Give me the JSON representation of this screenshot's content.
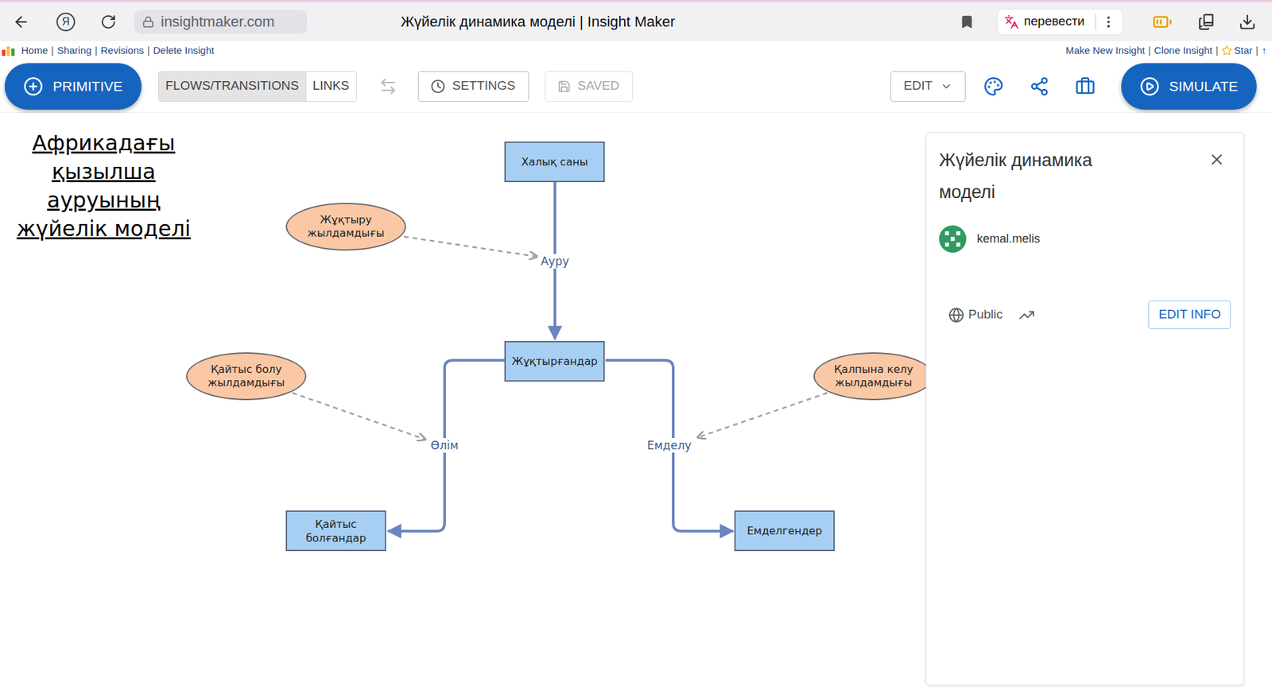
{
  "browser": {
    "yandex_logo": "Я",
    "address": "insightmaker.com",
    "title": "Жүйелік динамика моделі | Insight Maker",
    "translate": "перевести"
  },
  "links": {
    "separator": "|",
    "left": [
      "Home",
      "Sharing",
      "Revisions",
      "Delete Insight"
    ],
    "right": [
      {
        "label": "Make New Insight",
        "kind": "link"
      },
      {
        "label": "Clone Insight",
        "kind": "link"
      },
      {
        "label": "Star",
        "kind": "star"
      },
      {
        "label": "↑",
        "kind": "link"
      }
    ]
  },
  "toolbar": {
    "primitive": "PRIMITIVE",
    "modes": [
      {
        "label": "FLOWS/TRANSITIONS",
        "selected": true
      },
      {
        "label": "LINKS",
        "selected": false
      }
    ],
    "settings": "SETTINGS",
    "save": {
      "label": "SAVED",
      "disabled": true
    },
    "edit": "EDIT",
    "simulate": "SIMULATE"
  },
  "diagram": {
    "title": "Африкадағы қызылша ауруының жүйелік моделі",
    "stocks": [
      {
        "label": "Халық саны"
      },
      {
        "label": "Жұқтырғандар"
      },
      {
        "label": "Қайтыс болғандар"
      },
      {
        "label": "Емделгендер"
      }
    ],
    "variables": [
      {
        "label": "Жұқтыру жылдамдығы"
      },
      {
        "label": "Қайтыс болу жылдамдығы"
      },
      {
        "label": "Қалпына келу жылдамдығы"
      }
    ],
    "flows": [
      {
        "label": "Ауру"
      },
      {
        "label": "Өлім"
      },
      {
        "label": "Емделу"
      }
    ],
    "links": [
      {
        "from": "Жұқтыру жылдамдығы",
        "to": "Ауру"
      },
      {
        "from": "Қайтыс болу жылдамдығы",
        "to": "Өлім"
      },
      {
        "from": "Қалпына келу жылдамдығы",
        "to": "Емделу"
      }
    ]
  },
  "panel": {
    "title": "Жүйелік динамика моделі",
    "author": "kemal.melis",
    "visibility": "Public",
    "edit_button": "EDIT INFO"
  }
}
